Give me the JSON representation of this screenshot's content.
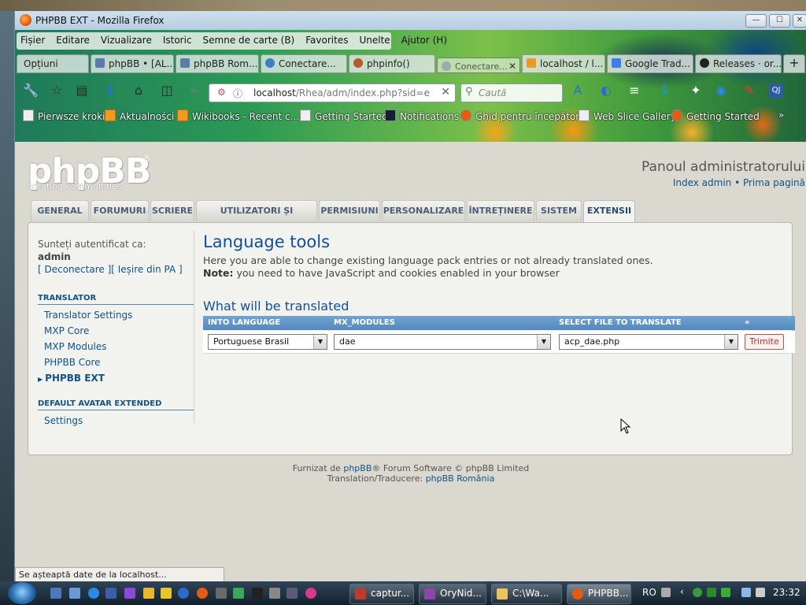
{
  "window": {
    "title": "PHPBB EXT - Mozilla Firefox",
    "controls": [
      "—",
      "☐",
      "✕"
    ]
  },
  "menu": [
    "Fișier",
    "Editare",
    "Vizualizare",
    "Istoric",
    "Semne de carte (B)",
    "Favorites",
    "Unelte",
    "Ajutor (H)"
  ],
  "tabs": [
    {
      "label": "Opțiuni",
      "icon_color": "#cfd6d0"
    },
    {
      "label": "phpBB • [AL...",
      "icon_color": "#5a7ca8"
    },
    {
      "label": "phpBB Rom...",
      "icon_color": "#5a7ca8"
    },
    {
      "label": "Conectare...",
      "icon_color": "#3a7fc8"
    },
    {
      "label": "phpinfo()",
      "icon_color": "#b55a2a"
    },
    {
      "label": "Conectare...",
      "icon_color": "#9aaab0",
      "close": "✕"
    },
    {
      "label": "localhost / l...",
      "icon_color": "#e69a2a"
    },
    {
      "label": "Google Trad...",
      "icon_color": "#3a7fe8"
    },
    {
      "label": "Releases · or...",
      "icon_color": "#222222"
    }
  ],
  "new_tab": "+",
  "navigation": {
    "url_host": "localhost",
    "url_path": "/Rhea/adm/index.php?sid=e",
    "search_placeholder": "Caută",
    "clear": "✕"
  },
  "bookmarks": [
    {
      "label": "Pierwsze kroki",
      "rss": false
    },
    {
      "label": "Aktualności",
      "rss": true
    },
    {
      "label": "Wikibooks - Recent c...",
      "rss": true
    },
    {
      "label": "Getting Started",
      "rss": false
    },
    {
      "label": "Notifications",
      "rss": false
    },
    {
      "label": "Ghid pentru începători",
      "rss": false
    },
    {
      "label": "Web Slice Gallery",
      "rss": false
    },
    {
      "label": "Getting Started",
      "rss": false
    }
  ],
  "bookmarks_more": "»",
  "site": {
    "logo": "phpBB",
    "logo_reg": "®",
    "slogan": "creating   communities",
    "panel_title": "Panoul administratorului",
    "toplinks": "Index admin • Prima pagină"
  },
  "acp_tabs": [
    "GENERAL",
    "FORUMURI",
    "SCRIERE",
    "UTILIZATORI ȘI GRUPURI",
    "PERMISIUNI",
    "PERSONALIZARE",
    "ÎNTREȚINERE",
    "SISTEM",
    "EXTENSII"
  ],
  "active_tab": "EXTENSII",
  "sidebar": {
    "logged_in_as": "Sunteți autentificat ca:",
    "username": "admin",
    "links": "[ Deconectare ][ Ieșire din PA ]",
    "sections": [
      {
        "title": "TRANSLATOR",
        "items": [
          "Translator Settings",
          "MXP Core",
          "MXP Modules",
          "PHPBB Core",
          "PHPBB EXT"
        ]
      },
      {
        "title": "DEFAULT AVATAR EXTENDED",
        "items": [
          "Settings"
        ]
      }
    ],
    "current": "PHPBB EXT"
  },
  "main": {
    "title": "Language tools",
    "description": "Here you are able to change existing language pack entries or not already translated ones.",
    "note_label": "Note:",
    "note_text": " you need to have JavaScript and cookies enabled in your browser",
    "subtitle": "What will be translated",
    "table": {
      "headers": [
        "INTO LANGUAGE",
        "MX_MODULES",
        "SELECT FILE TO TRANSLATE",
        "«"
      ],
      "language_value": "Portuguese Brasil",
      "module_value": "dae",
      "file_value": "acp_dae.php",
      "submit_label": "Trimite"
    }
  },
  "footer": {
    "line1_prefix": "Furnizat de ",
    "line1_link": "phpBB",
    "line1_suffix": "® Forum Software © phpBB Limited",
    "line2_prefix": "Translation/Traducere: ",
    "line2_link": "phpBB România"
  },
  "status": "Se așteaptă date de la localhost...",
  "taskbar": {
    "buttons": [
      {
        "label": "captur...",
        "icon_color": "#c0392b"
      },
      {
        "label": "OryNid...",
        "icon_color": "#8e44ad"
      },
      {
        "label": "C:\\Wa...",
        "icon_color": "#e8c560"
      },
      {
        "label": "PHPBB...",
        "icon_color": "#e55b13"
      }
    ],
    "lang": "RO",
    "clock": "23:32"
  }
}
